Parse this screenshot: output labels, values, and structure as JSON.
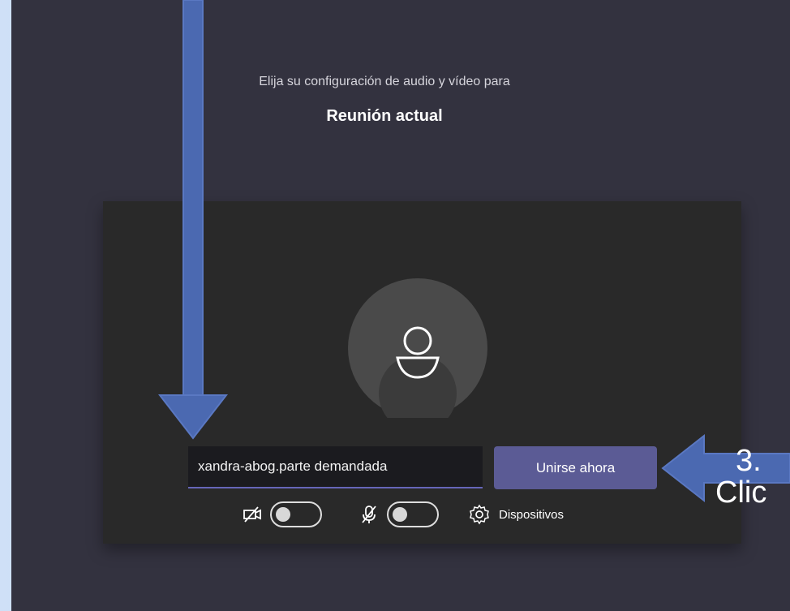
{
  "meeting": {
    "prompt": "Elija su configuración de audio y vídeo para",
    "title": "Reunión actual"
  },
  "join": {
    "name_value": "xandra-abog.parte demandada",
    "join_button_label": "Unirse ahora"
  },
  "controls": {
    "devices_label": "Dispositivos",
    "camera_enabled": false,
    "mic_enabled": false
  },
  "annotation": {
    "step": "3.",
    "click": "Clic"
  },
  "icons": {
    "avatar": "person-avatar-icon",
    "camera": "camera-off-icon",
    "microphone": "microphone-off-icon",
    "devices": "gear-icon"
  },
  "colors": {
    "window_background": "#33323f",
    "card_background": "#292929",
    "avatar_background": "#4a4a4a",
    "join_button": "#5b5b95",
    "input_focus_line": "#6666b8",
    "annotation_arrow": "#4b69b1"
  }
}
